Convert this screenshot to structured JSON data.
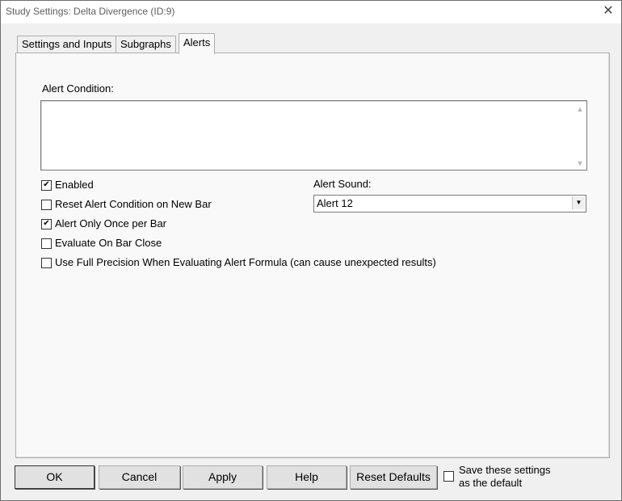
{
  "window": {
    "title": "Study Settings: Delta Divergence (ID:9)",
    "close_glyph": "✕"
  },
  "tabs": [
    {
      "label": "Settings and Inputs",
      "active": false
    },
    {
      "label": "Subgraphs",
      "active": false
    },
    {
      "label": "Alerts",
      "active": true
    }
  ],
  "alerts": {
    "condition_label": "Alert Condition:",
    "condition_value": "",
    "sound_label": "Alert Sound:",
    "sound_value": "Alert 12",
    "options": [
      {
        "label": "Enabled",
        "checked": true
      },
      {
        "label": "Reset Alert Condition on New Bar",
        "checked": false
      },
      {
        "label": "Alert Only Once per Bar",
        "checked": true
      },
      {
        "label": "Evaluate On Bar Close",
        "checked": false
      },
      {
        "label": "Use Full Precision When Evaluating Alert Formula (can cause unexpected results)",
        "checked": false
      }
    ]
  },
  "footer": {
    "ok_label": "OK",
    "cancel_label": "Cancel",
    "apply_label": "Apply",
    "help_label": "Help",
    "reset_label": "Reset Defaults",
    "save_default_line1": "Save these settings",
    "save_default_line2": "as the default",
    "save_default_checked": false
  },
  "icons": {
    "check": "✔",
    "scroll_up": "▲",
    "scroll_down": "▼",
    "dropdown": "▼"
  }
}
